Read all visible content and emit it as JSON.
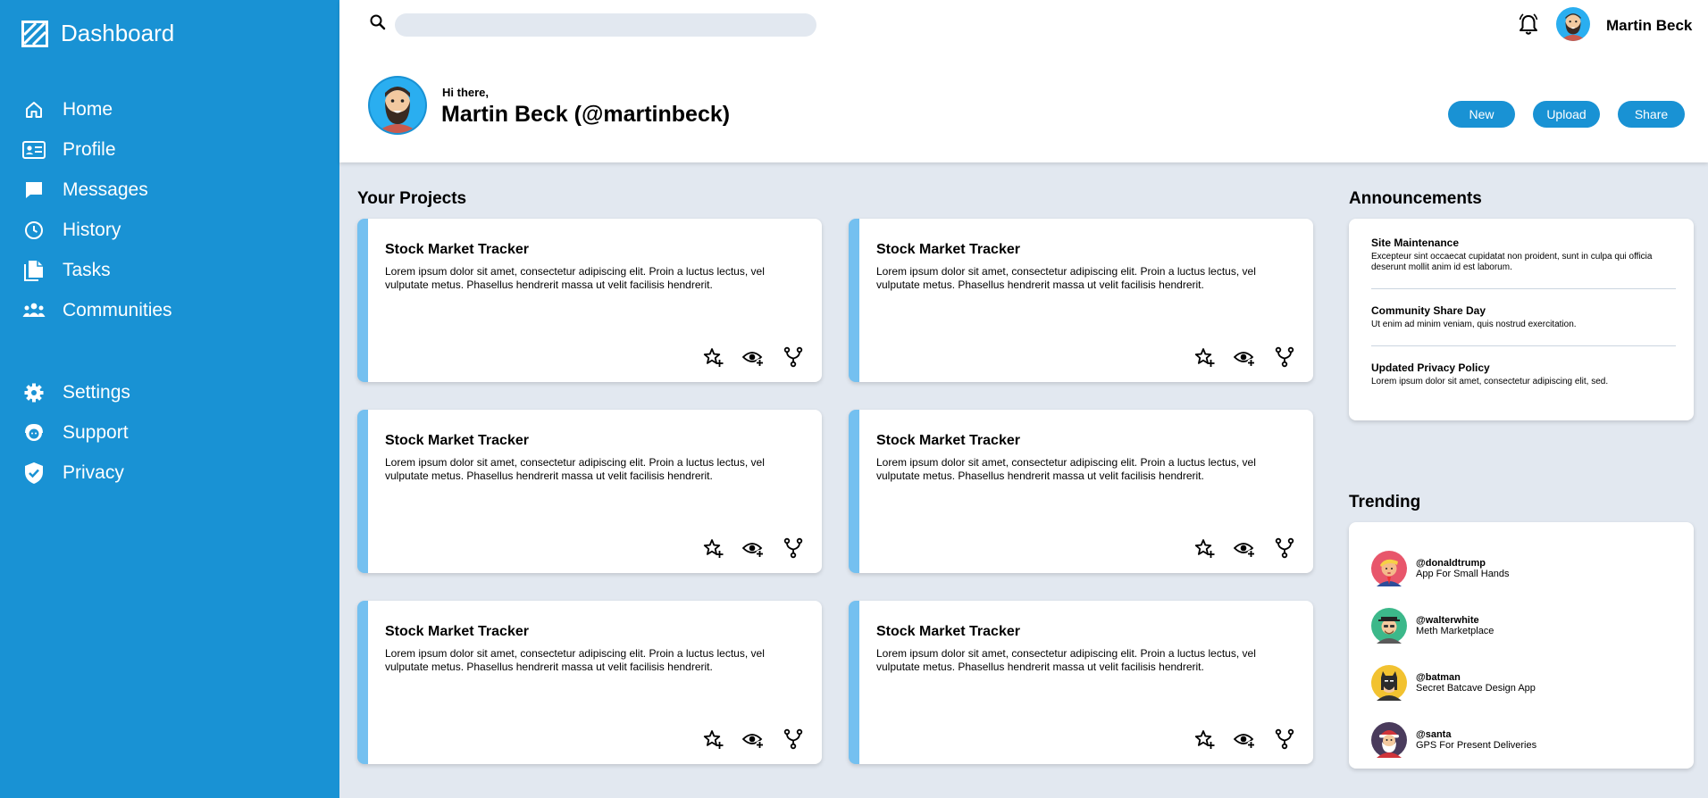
{
  "app": {
    "title": "Dashboard"
  },
  "sidebar": {
    "items": [
      {
        "label": "Home",
        "icon": "home-icon"
      },
      {
        "label": "Profile",
        "icon": "id-card-icon"
      },
      {
        "label": "Messages",
        "icon": "chat-bubble-icon"
      },
      {
        "label": "History",
        "icon": "clock-icon"
      },
      {
        "label": "Tasks",
        "icon": "documents-icon"
      },
      {
        "label": "Communities",
        "icon": "people-icon"
      }
    ],
    "secondary": [
      {
        "label": "Settings",
        "icon": "gear-icon"
      },
      {
        "label": "Support",
        "icon": "support-agent-icon"
      },
      {
        "label": "Privacy",
        "icon": "shield-check-icon"
      }
    ]
  },
  "topbar": {
    "search": {
      "placeholder": "",
      "value": ""
    },
    "username": "Martin Beck"
  },
  "hero": {
    "greeting": "Hi there,",
    "name": "Martin Beck (@martinbeck)",
    "buttons": {
      "new": "New",
      "upload": "Upload",
      "share": "Share"
    }
  },
  "projects": {
    "title": "Your Projects",
    "items": [
      {
        "title": "Stock Market Tracker",
        "description": "Lorem ipsum dolor sit amet, consectetur adipiscing elit. Proin a luctus lectus, vel vulputate metus. Phasellus hendrerit massa ut velit facilisis hendrerit."
      },
      {
        "title": "Stock Market Tracker",
        "description": "Lorem ipsum dolor sit amet, consectetur adipiscing elit. Proin a luctus lectus, vel vulputate metus. Phasellus hendrerit massa ut velit facilisis hendrerit."
      },
      {
        "title": "Stock Market Tracker",
        "description": "Lorem ipsum dolor sit amet, consectetur adipiscing elit. Proin a luctus lectus, vel vulputate metus. Phasellus hendrerit massa ut velit facilisis hendrerit."
      },
      {
        "title": "Stock Market Tracker",
        "description": "Lorem ipsum dolor sit amet, consectetur adipiscing elit. Proin a luctus lectus, vel vulputate metus. Phasellus hendrerit massa ut velit facilisis hendrerit."
      },
      {
        "title": "Stock Market Tracker",
        "description": "Lorem ipsum dolor sit amet, consectetur adipiscing elit. Proin a luctus lectus, vel vulputate metus. Phasellus hendrerit massa ut velit facilisis hendrerit."
      },
      {
        "title": "Stock Market Tracker",
        "description": "Lorem ipsum dolor sit amet, consectetur adipiscing elit. Proin a luctus lectus, vel vulputate metus. Phasellus hendrerit massa ut velit facilisis hendrerit."
      }
    ]
  },
  "announcements": {
    "title": "Announcements",
    "items": [
      {
        "heading": "Site Maintenance",
        "text": "Excepteur sint occaecat cupidatat non proident, sunt in culpa qui officia deserunt mollit anim id est laborum."
      },
      {
        "heading": "Community Share Day",
        "text": "Ut enim ad minim veniam, quis nostrud exercitation."
      },
      {
        "heading": "Updated Privacy Policy",
        "text": "Lorem ipsum dolor sit amet, consectetur adipiscing elit, sed."
      }
    ]
  },
  "trending": {
    "title": "Trending",
    "items": [
      {
        "handle": "@donaldtrump",
        "project": "App For Small Hands"
      },
      {
        "handle": "@walterwhite",
        "project": "Meth Marketplace"
      },
      {
        "handle": "@batman",
        "project": "Secret Batcave Design App"
      },
      {
        "handle": "@santa",
        "project": "GPS For Present Deliveries"
      }
    ]
  },
  "colors": {
    "sidebar": "#1992d4",
    "accent": "#74c0f0",
    "background": "#e2e8f0",
    "button": "#1992d4"
  }
}
